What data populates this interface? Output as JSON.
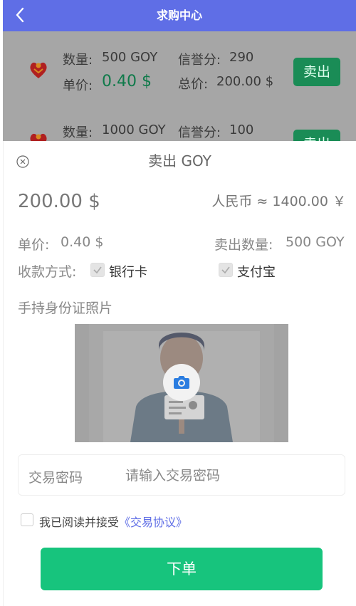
{
  "header": {
    "title": "求购中心",
    "back_icon": "chevron-left-icon"
  },
  "orders": [
    {
      "quantity_label": "数量:",
      "quantity": "500 GOY",
      "reputation_label": "信誉分:",
      "reputation": "290",
      "unit_price_label": "单价:",
      "unit_price": "0.40 $",
      "total_label": "总价:",
      "total": "200.00 $",
      "sell_label": "卖出"
    },
    {
      "quantity_label": "数量:",
      "quantity": "1000 GOY",
      "reputation_label": "信誉分:",
      "reputation": "100",
      "sell_label": "卖出"
    }
  ],
  "sheet": {
    "title": "卖出 GOY",
    "amount": "200.00 $",
    "rmb_label": "人民币 ≈ 1400.00 ￥",
    "unit_price_label": "单价:",
    "unit_price": "0.40 $",
    "sell_qty_label": "卖出数量:",
    "sell_qty": "500 GOY",
    "payment_label": "收款方式:",
    "payment_options": [
      {
        "label": "银行卡",
        "checked": true
      },
      {
        "label": "支付宝",
        "checked": true
      }
    ],
    "id_photo_label": "手持身份证照片",
    "password_label": "交易密码",
    "password_placeholder": "请输入交易密码",
    "agree_text": "我已阅读并接受",
    "agree_link": "《交易协议》",
    "submit_label": "下单"
  },
  "colors": {
    "header": "#5f6ee6",
    "submit": "#17c47d",
    "sell_button": "#1a8c56",
    "price": "#0f7a4a"
  }
}
